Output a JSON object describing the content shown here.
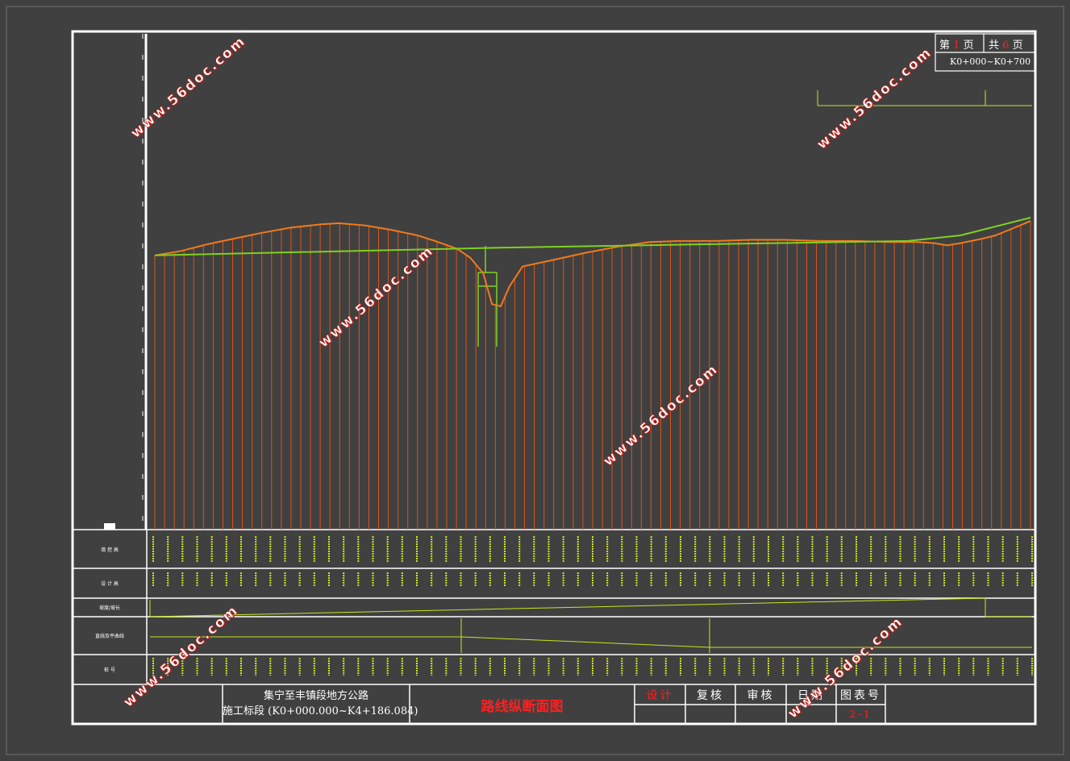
{
  "page_info": {
    "prefix": "第",
    "page": "1",
    "mid": "页",
    "total_prefix": "共",
    "total": "6",
    "suffix": "页",
    "range": "K0+000~K0+700"
  },
  "title_block": {
    "project_line1": "集宁至丰镇段地方公路",
    "project_line2": "施工标段 (K0+000.000~K4+186.084)",
    "drawing_name": "路线纵断面图",
    "design": "设计",
    "check": "复核",
    "review": "审核",
    "date": "日期",
    "drawing_no_label": "图表号",
    "drawing_no": "2-1"
  },
  "row_labels": [
    "填 挖 高",
    "设 计 高",
    "坡度/坡长",
    "直线及平曲线",
    "桩 号"
  ],
  "watermark": "www.56doc.com",
  "colors": {
    "ground": "#f07a1c",
    "hatch": "#d9541a",
    "design": "#7fd21e",
    "frame": "#ffffff",
    "background": "#404040",
    "title_red": "#ff2020"
  },
  "chart_data": {
    "type": "line",
    "series": [
      {
        "role": "ground-line",
        "values": [
          [
            0,
            0.3
          ],
          [
            0.03,
            0.34
          ],
          [
            0.06,
            0.4
          ],
          [
            0.09,
            0.45
          ],
          [
            0.12,
            0.5
          ],
          [
            0.155,
            0.55
          ],
          [
            0.19,
            0.58
          ],
          [
            0.21,
            0.59
          ],
          [
            0.24,
            0.57
          ],
          [
            0.27,
            0.53
          ],
          [
            0.3,
            0.48
          ],
          [
            0.32,
            0.43
          ],
          [
            0.345,
            0.36
          ],
          [
            0.36,
            0.28
          ],
          [
            0.375,
            0.14
          ],
          [
            0.385,
            -0.14
          ],
          [
            0.395,
            -0.16
          ],
          [
            0.405,
            0.02
          ],
          [
            0.42,
            0.2
          ],
          [
            0.45,
            0.25
          ],
          [
            0.49,
            0.32
          ],
          [
            0.53,
            0.38
          ],
          [
            0.565,
            0.42
          ],
          [
            0.6,
            0.43
          ],
          [
            0.64,
            0.43
          ],
          [
            0.68,
            0.44
          ],
          [
            0.72,
            0.44
          ],
          [
            0.76,
            0.43
          ],
          [
            0.8,
            0.43
          ],
          [
            0.84,
            0.42
          ],
          [
            0.87,
            0.42
          ],
          [
            0.89,
            0.41
          ],
          [
            0.905,
            0.39
          ],
          [
            0.92,
            0.41
          ],
          [
            0.945,
            0.45
          ],
          [
            0.96,
            0.48
          ],
          [
            0.985,
            0.56
          ],
          [
            1.0,
            0.61
          ]
        ]
      },
      {
        "role": "design-grade-line",
        "values": [
          [
            0,
            0.3
          ],
          [
            0.4,
            0.37
          ],
          [
            0.86,
            0.43
          ],
          [
            0.92,
            0.48
          ],
          [
            1.0,
            0.64
          ]
        ]
      }
    ],
    "grid": false
  }
}
